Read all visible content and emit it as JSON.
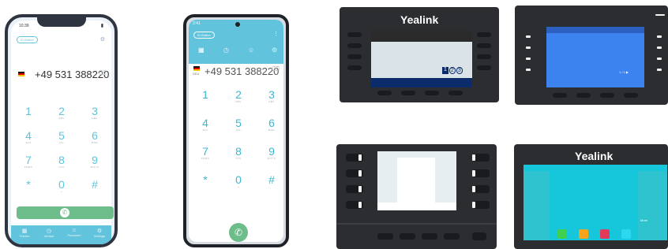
{
  "iphone": {
    "status_time": "10:39",
    "id_button": "ID Button",
    "number": "+49 531 388220",
    "keys": [
      {
        "d": "1",
        "l": ""
      },
      {
        "d": "2",
        "l": "ABC"
      },
      {
        "d": "3",
        "l": "DEF"
      },
      {
        "d": "4",
        "l": "GHI"
      },
      {
        "d": "5",
        "l": "JKL"
      },
      {
        "d": "6",
        "l": "MNO"
      },
      {
        "d": "7",
        "l": "PQRS"
      },
      {
        "d": "8",
        "l": "TUV"
      },
      {
        "d": "9",
        "l": "WXYZ"
      },
      {
        "d": "*",
        "l": ""
      },
      {
        "d": "0",
        "l": "+"
      },
      {
        "d": "#",
        "l": ""
      }
    ],
    "tabs": [
      "Telefon",
      "Verlauf",
      "Personen",
      "Settings"
    ]
  },
  "android": {
    "status_time": "2:41",
    "id_button": "ID Button",
    "country_code": "DEU",
    "number": "+49 531 388220",
    "keys": [
      {
        "d": "1",
        "l": ""
      },
      {
        "d": "2",
        "l": "ABC"
      },
      {
        "d": "3",
        "l": "DEF"
      },
      {
        "d": "4",
        "l": "GHI"
      },
      {
        "d": "5",
        "l": "JKL"
      },
      {
        "d": "6",
        "l": "MNO"
      },
      {
        "d": "7",
        "l": "PQRS"
      },
      {
        "d": "8",
        "l": "TUV"
      },
      {
        "d": "9",
        "l": "WXYZ"
      },
      {
        "d": "*",
        "l": ""
      },
      {
        "d": "0",
        "l": "+"
      },
      {
        "d": "#",
        "l": ""
      }
    ]
  },
  "desk1": {
    "brand": "Yealink",
    "lines": [
      "1",
      "2",
      "3"
    ]
  },
  "desk2": {
    "badge": "1 / 1 ▶"
  },
  "desk4": {
    "brand": "Yealink",
    "more_label": "More"
  },
  "colors": {
    "accent": "#62c3dd",
    "call": "#6cbd8a"
  }
}
